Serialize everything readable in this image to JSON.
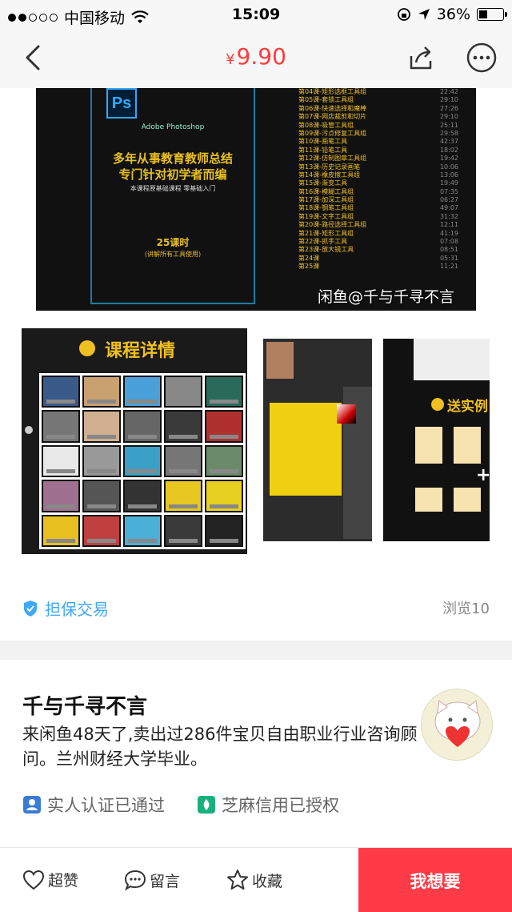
{
  "status_bar": {
    "carrier": "中国移动",
    "time": "15:09",
    "battery": "36%",
    "battery_level": 0.36
  },
  "nav": {
    "price_symbol": "¥",
    "price_value": "9.90"
  },
  "listing_image_1": {
    "app_name": "Adobe Photoshop",
    "headline_1": "多年从事教育教师总结",
    "headline_2": "专门针对初学者而编",
    "subline": "本课程原基础课程 零基础入门",
    "hours": "25课时",
    "hours_note": "(讲解所有工具使用)",
    "lessons": [
      {
        "title": "第04课-矩形选框工具组",
        "time": "22:42"
      },
      {
        "title": "第05课-套锁工具组",
        "time": "29:10"
      },
      {
        "title": "第06课-快速选择和魔棒",
        "time": "27:26"
      },
      {
        "title": "第07课-网店裁剪和切片",
        "time": "29:10"
      },
      {
        "title": "第08课-吸管工具组",
        "time": "25:11"
      },
      {
        "title": "第09课-污点修复工具组",
        "time": "29:58"
      },
      {
        "title": "第10课-画笔工具",
        "time": "42:37"
      },
      {
        "title": "第11课-铅笔工具",
        "time": "18:02"
      },
      {
        "title": "第12课-仿制图章工具组",
        "time": "19:42"
      },
      {
        "title": "第13课-历史记录画笔",
        "time": "10:06"
      },
      {
        "title": "第14课-橡皮擦工具组",
        "time": "13:06"
      },
      {
        "title": "第15课-渐变工具",
        "time": "19:49"
      },
      {
        "title": "第16课-模糊工具组",
        "time": "07:35"
      },
      {
        "title": "第17课-加深工具组",
        "time": "06:27"
      },
      {
        "title": "第18课-钢笔工具组",
        "time": "49:07"
      },
      {
        "title": "第19课-文字工具组",
        "time": "31:32"
      },
      {
        "title": "第20课-路径选择工具组",
        "time": "12:11"
      },
      {
        "title": "第21课-矩形工具组",
        "time": "41:19"
      },
      {
        "title": "第22课-抓手工具",
        "time": "07:08"
      },
      {
        "title": "第23课-放大镜工具",
        "time": "08:51"
      },
      {
        "title": "第24课",
        "time": "05:31"
      },
      {
        "title": "第25课",
        "time": "11:21"
      }
    ],
    "watermark": "闲鱼@千与千寻不言"
  },
  "listing_image_2": {
    "title": "课程详情"
  },
  "listing_image_4": {
    "title": "送实例"
  },
  "trade": {
    "label": "担保交易",
    "views": "浏览10"
  },
  "seller": {
    "name": "千与千寻不言",
    "bio": "来闲鱼48天了,卖出过286件宝贝自由职业行业咨询顾问。兰州财经大学毕业。",
    "badge_realname": "实人认证已通过",
    "badge_sesame": "芝麻信用已授权"
  },
  "bottom_bar": {
    "like": "超赞",
    "comment": "留言",
    "favorite": "收藏",
    "want": "我想要"
  },
  "colors": {
    "price_red": "#ff3b3b",
    "want_red": "#ff3b47",
    "trade_blue": "#3fa9f5",
    "ps_yellow": "#f0c020"
  }
}
